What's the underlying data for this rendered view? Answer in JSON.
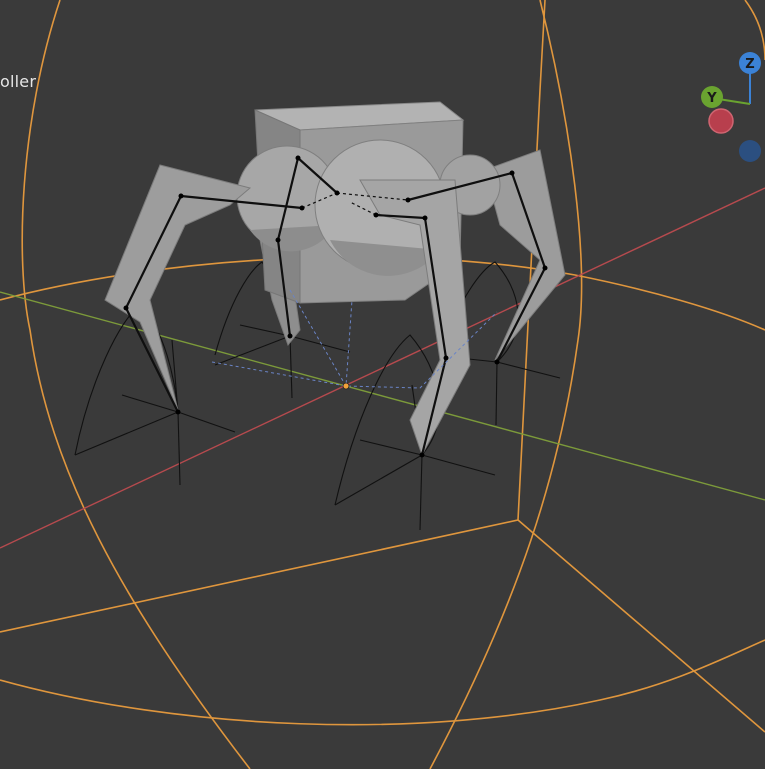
{
  "viewport": {
    "overlay_label": "oller",
    "background": "#3a3a3a"
  },
  "gizmo": {
    "z_label": "Z",
    "y_label": "Y",
    "z_color": "#3b82d6",
    "y_color": "#6aa330",
    "x_color": "#c64050",
    "neg_z_color": "#2b4f80"
  },
  "colors": {
    "mesh": "#9a9a9a",
    "armature": "#0f0f0f",
    "light_range": "#e89b3e",
    "x_axis": "#b64a4e",
    "y_axis": "#7c9a3a"
  }
}
